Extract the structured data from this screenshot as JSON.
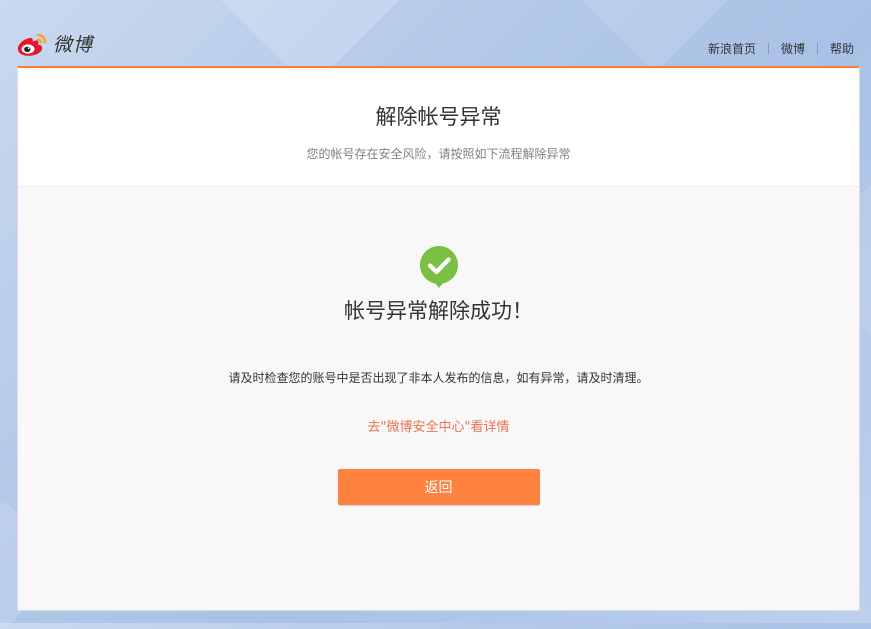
{
  "header": {
    "logo_text": "微博",
    "nav": [
      {
        "label": "新浪首页"
      },
      {
        "label": "微博"
      },
      {
        "label": "帮助"
      }
    ]
  },
  "card": {
    "title": "解除帐号异常",
    "subtitle": "您的帐号存在安全风险，请按照如下流程解除异常",
    "success_title": "帐号异常解除成功！",
    "notice": "请及时检查您的账号中是否出现了非本人发布的信息，如有异常，请及时清理。",
    "security_link": "去\"微博安全中心\"看详情",
    "back_button": "返回"
  },
  "colors": {
    "accent": "#ff8140",
    "link": "#eb7350",
    "success": "#7ac043"
  },
  "icons": {
    "logo": "weibo-eye-icon",
    "success": "checkmark-pin-icon"
  }
}
